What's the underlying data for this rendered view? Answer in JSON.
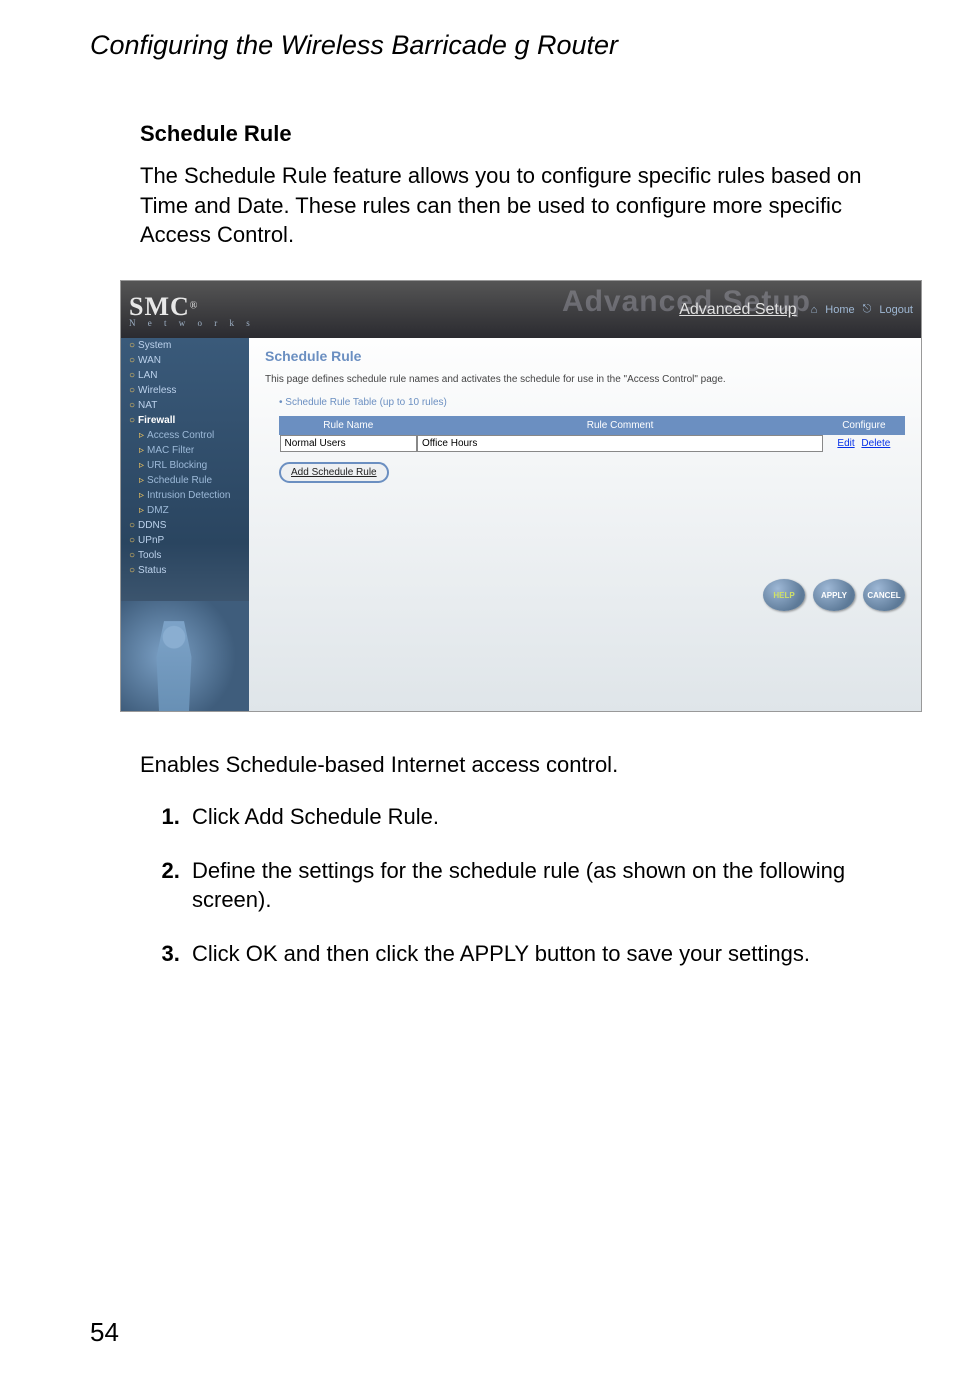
{
  "doc": {
    "title": "Configuring the Wireless Barricade g Router",
    "section_title": "Schedule Rule",
    "intro": "The Schedule Rule feature allows you to configure specific rules based on Time and Date. These rules can then be used to configure more specific Access Control.",
    "enable_text": "Enables Schedule-based Internet access control.",
    "steps": [
      "Click Add Schedule Rule.",
      "Define the settings for the schedule rule (as shown on the following screen).",
      "Click OK and then click the APPLY button to save your settings."
    ],
    "page_number": "54"
  },
  "shot": {
    "logo": {
      "main": "SMC",
      "reg": "®",
      "sub": "N e t w o r k s"
    },
    "watermark": "Advanced Setup",
    "adv_setup": "Advanced Setup",
    "nav": {
      "home": "Home",
      "logout": "Logout"
    },
    "sidebar": {
      "top": [
        "System",
        "WAN",
        "LAN",
        "Wireless",
        "NAT",
        "Firewall"
      ],
      "sub": [
        "Access Control",
        "MAC Filter",
        "URL Blocking",
        "Schedule Rule",
        "Intrusion Detection",
        "DMZ"
      ],
      "bottom": [
        "DDNS",
        "UPnP",
        "Tools",
        "Status"
      ]
    },
    "content": {
      "title": "Schedule Rule",
      "desc": "This page defines schedule rule names and activates the schedule for use in the \"Access Control\" page.",
      "table_caption": "• Schedule Rule Table (up to 10 rules)",
      "headers": [
        "Rule Name",
        "Rule Comment",
        "Configure"
      ],
      "row": {
        "name": "Normal Users",
        "comment": "Office Hours",
        "edit": "Edit",
        "delete": "Delete"
      },
      "add_btn": "Add Schedule Rule"
    },
    "buttons": {
      "help": "HELP",
      "apply": "APPLY",
      "cancel": "CANCEL"
    }
  }
}
